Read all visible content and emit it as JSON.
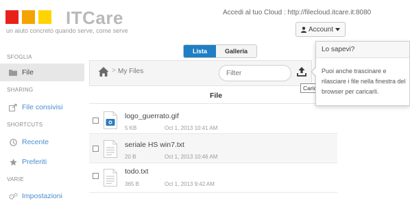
{
  "brand": {
    "name": "ITCare",
    "tagline": "un aiuto concreto quando serve, come serve",
    "colors": [
      "#e8221b",
      "#f5a300",
      "#ffd400"
    ]
  },
  "header": {
    "cloud_url": "Accedi al tuo Cloud : http://filecloud.itcare.it:8080",
    "account_label": "Account",
    "account_icon": "user-icon",
    "caret_icon": "caret-down-icon"
  },
  "sidebar": {
    "sections": [
      {
        "heading": "SFOGLIA",
        "items": [
          {
            "label": "File",
            "icon": "folder-icon",
            "active": true
          }
        ]
      },
      {
        "heading": "SHARING",
        "items": [
          {
            "label": "File consivisi",
            "icon": "share-icon",
            "active": false
          }
        ]
      },
      {
        "heading": "SHORTCUTS",
        "items": [
          {
            "label": "Recente",
            "icon": "clock-icon",
            "active": false
          },
          {
            "label": "Preferiti",
            "icon": "star-icon",
            "active": false
          }
        ]
      },
      {
        "heading": "VARIE",
        "items": [
          {
            "label": "Impostazioni",
            "icon": "gears-icon",
            "active": false
          }
        ]
      }
    ]
  },
  "view_toggle": {
    "list": "Lista",
    "gallery": "Galleria",
    "selected": "Lista",
    "accent": "#1e7fc4"
  },
  "toolbar": {
    "breadcrumb_sep": ">",
    "breadcrumb": "My Files",
    "filter_placeholder": "Filter",
    "upload_tooltip": "Carica"
  },
  "table": {
    "column_header": "File",
    "rows": [
      {
        "name": "logo_guerrato.gif",
        "size": "5 KB",
        "date": "Oct 1, 2013 10:41 AM",
        "icon": "image-file-icon"
      },
      {
        "name": "seriale HS win7.txt",
        "size": "20 B",
        "date": "Oct 1, 2013 10:46 AM",
        "icon": "text-file-icon"
      },
      {
        "name": "todo.txt",
        "size": "365 B",
        "date": "Oct 1, 2013 9:42 AM",
        "icon": "text-file-icon"
      }
    ]
  },
  "popover": {
    "title": "Lo sapevi?",
    "body": "Puoi anche trascinare e rilasciare i file nella finestra del browser per caricarli."
  }
}
